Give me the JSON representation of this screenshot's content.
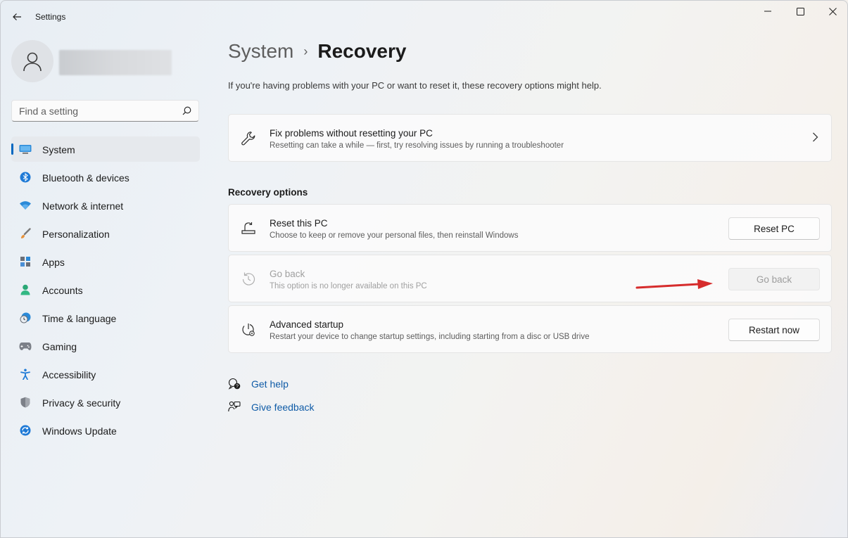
{
  "window": {
    "app_title": "Settings"
  },
  "search": {
    "placeholder": "Find a setting",
    "value": ""
  },
  "sidebar": {
    "items": [
      {
        "label": "System",
        "icon": "system-icon",
        "active": true
      },
      {
        "label": "Bluetooth & devices",
        "icon": "bluetooth-icon"
      },
      {
        "label": "Network & internet",
        "icon": "wifi-icon"
      },
      {
        "label": "Personalization",
        "icon": "brush-icon"
      },
      {
        "label": "Apps",
        "icon": "apps-icon"
      },
      {
        "label": "Accounts",
        "icon": "accounts-icon"
      },
      {
        "label": "Time & language",
        "icon": "time-language-icon"
      },
      {
        "label": "Gaming",
        "icon": "gamepad-icon"
      },
      {
        "label": "Accessibility",
        "icon": "accessibility-icon"
      },
      {
        "label": "Privacy & security",
        "icon": "shield-icon"
      },
      {
        "label": "Windows Update",
        "icon": "update-icon"
      }
    ]
  },
  "breadcrumb": {
    "parent": "System",
    "separator": "›",
    "current": "Recovery"
  },
  "main": {
    "intro": "If you're having problems with your PC or want to reset it, these recovery options might help.",
    "fix_card": {
      "title": "Fix problems without resetting your PC",
      "subtitle": "Resetting can take a while — first, try resolving issues by running a troubleshooter",
      "icon": "wrench-icon"
    },
    "section_title": "Recovery options",
    "options": [
      {
        "title": "Reset this PC",
        "subtitle": "Choose to keep or remove your personal files, then reinstall Windows",
        "button": "Reset PC",
        "icon": "reset-pc-icon",
        "enabled": true
      },
      {
        "title": "Go back",
        "subtitle": "This option is no longer available on this PC",
        "button": "Go back",
        "icon": "history-icon",
        "enabled": false
      },
      {
        "title": "Advanced startup",
        "subtitle": "Restart your device to change startup settings, including starting from a disc or USB drive",
        "button": "Restart now",
        "icon": "advanced-startup-icon",
        "enabled": true
      }
    ],
    "links": [
      {
        "label": "Get help",
        "icon": "help-icon"
      },
      {
        "label": "Give feedback",
        "icon": "feedback-icon"
      }
    ]
  },
  "colors": {
    "accent": "#0067c0",
    "link": "#0f5ba7",
    "annotation_arrow": "#d62c2c"
  }
}
